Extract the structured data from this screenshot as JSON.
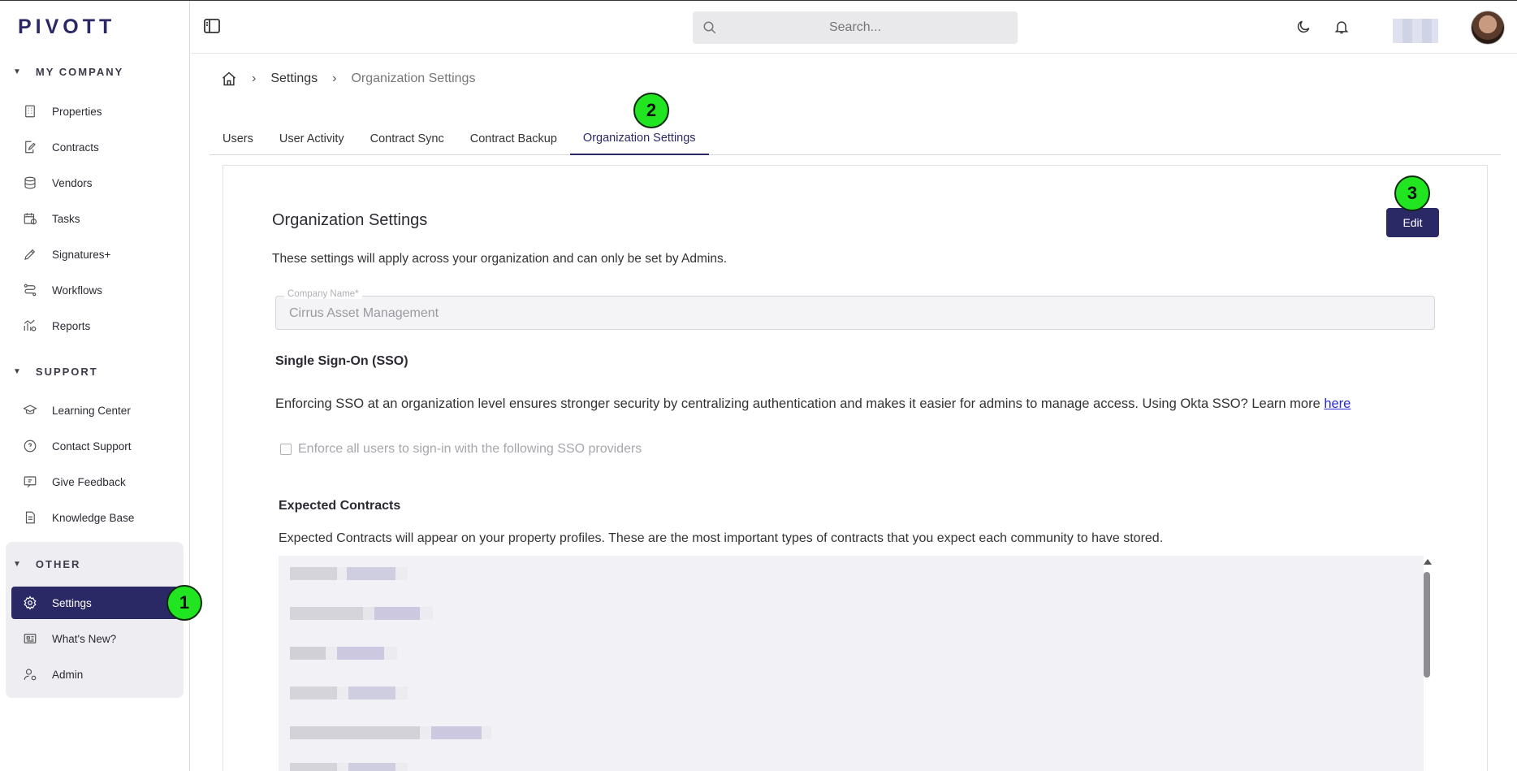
{
  "app": {
    "logo_text": "PIVOTT",
    "brand_color": "#2b2866",
    "marker_color": "#22e522"
  },
  "sidebar": {
    "sections": [
      {
        "title": "MY COMPANY",
        "items": [
          {
            "label": "Properties",
            "icon": "building-icon"
          },
          {
            "label": "Contracts",
            "icon": "contract-pen-icon"
          },
          {
            "label": "Vendors",
            "icon": "database-icon"
          },
          {
            "label": "Tasks",
            "icon": "calendar-clock-icon"
          },
          {
            "label": "Signatures+",
            "icon": "signature-icon"
          },
          {
            "label": "Workflows",
            "icon": "workflow-icon"
          },
          {
            "label": "Reports",
            "icon": "chart-gear-icon"
          }
        ]
      },
      {
        "title": "SUPPORT",
        "items": [
          {
            "label": "Learning Center",
            "icon": "graduation-cap-icon"
          },
          {
            "label": "Contact Support",
            "icon": "help-chat-icon"
          },
          {
            "label": "Give Feedback",
            "icon": "feedback-icon"
          },
          {
            "label": "Knowledge Base",
            "icon": "document-icon"
          }
        ]
      },
      {
        "title": "OTHER",
        "items": [
          {
            "label": "Settings",
            "icon": "gear-icon"
          },
          {
            "label": "What's New?",
            "icon": "newspaper-icon"
          },
          {
            "label": "Admin",
            "icon": "user-admin-icon"
          }
        ]
      }
    ]
  },
  "topbar": {
    "search_placeholder": "Search..."
  },
  "markers": [
    "1",
    "2",
    "3"
  ],
  "breadcrumb": {
    "items": [
      "Settings",
      "Organization Settings"
    ]
  },
  "tabs": [
    "Users",
    "User Activity",
    "Contract Sync",
    "Contract Backup",
    "Organization Settings"
  ],
  "panel": {
    "title": "Organization Settings",
    "edit_label": "Edit",
    "description": "These settings will apply across your organization and can only be set by Admins.",
    "company_field": {
      "label": "Company Name*",
      "value": "Cirrus Asset Management"
    },
    "sso": {
      "heading": "Single Sign-On (SSO)",
      "description": "Enforcing SSO at an organization level ensures stronger security by centralizing authentication and makes it easier for admins to manage access. Using Okta SSO? Learn more ",
      "link_text": "here",
      "checkbox_label": "Enforce all users to sign-in with the following SSO providers"
    },
    "expected": {
      "heading": "Expected Contracts",
      "description": "Expected Contracts will appear on your property profiles. These are the most important types of contracts that you expect each community to have stored."
    }
  }
}
